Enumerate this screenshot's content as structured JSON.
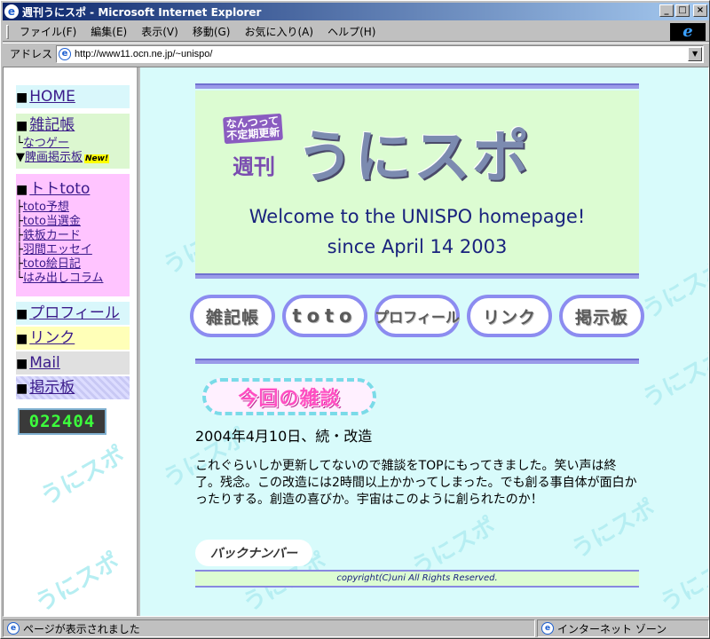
{
  "window": {
    "title": "週刊うにスポ - Microsoft Internet Explorer",
    "min_glyph": "_",
    "max_glyph": "□",
    "close_glyph": "×"
  },
  "menu": {
    "items": [
      "ファイル(F)",
      "編集(E)",
      "表示(V)",
      "移動(G)",
      "お気に入り(A)",
      "ヘルプ(H)"
    ]
  },
  "address": {
    "label": "アドレス",
    "url": "http://www11.ocn.ne.jp/~unispo/"
  },
  "sidebar": {
    "home": "HOME",
    "zakki": "雑記帳",
    "zakki_sub": [
      "なつゲー",
      "脾画掲示板"
    ],
    "new_badge": "New!",
    "toto": "トトtoto",
    "toto_sub": [
      "toto予想",
      "toto当選金",
      "鉄板カード",
      "羽間エッセイ",
      "toto絵日記",
      "はみ出しコラム"
    ],
    "profile": "プロフィール",
    "link": "リンク",
    "mail": "Mail",
    "bbs": "掲示板",
    "counter": "022404"
  },
  "banner": {
    "logo_sub": "なんつって不定期更新",
    "logo_weekly": "週刊",
    "logo_main": "うにスポ",
    "welcome": "Welcome to the UNISPO homepage!",
    "since": "since April 14 2003"
  },
  "nav_buttons": [
    "雑記帳",
    "toto",
    "プロフィール",
    "リンク",
    "掲示板"
  ],
  "post": {
    "badge": "今回の雑談",
    "date": "2004年4月10日、続・改造",
    "body": "これぐらいしか更新してないので雑談をTOPにもってきました。笑い声は終了。残念。この改造には2時間以上かかってしまった。でも創る事自体が面白かったりする。創造の喜びか。宇宙はこのように創られたのか！"
  },
  "backnumber": "バックナンバー",
  "footer": "copyright(C)uni All Rights Reserved.",
  "status": {
    "left": "ページが表示されました",
    "right": "インターネット ゾーン"
  },
  "watermark": "うにスポ",
  "colors": {
    "main_bg": "#d8fbfb",
    "banner_bg": "#dcfcd2",
    "rule": "#9a9ae8",
    "home_bg": "#d9f7fb",
    "zakki_bg": "#dcf7d0",
    "toto_bg": "#ffc4ff",
    "link_bg": "#ffffb8"
  }
}
